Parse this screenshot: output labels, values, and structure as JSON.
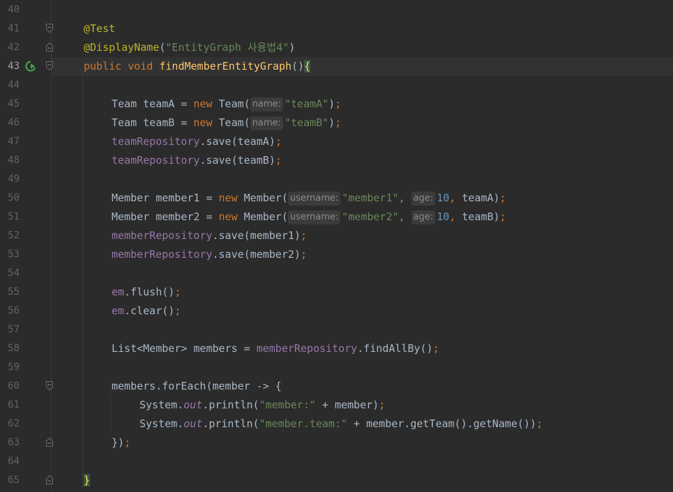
{
  "editor": {
    "current_line": "43",
    "lines": [
      {
        "n": "40",
        "tokens": []
      },
      {
        "n": "41",
        "tokens": [
          {
            "t": "@Test",
            "c": "ann"
          }
        ]
      },
      {
        "n": "42",
        "tokens": [
          {
            "t": "@DisplayName",
            "c": "ann"
          },
          {
            "t": "("
          },
          {
            "t": "\"EntityGraph 사용법4\"",
            "c": "str"
          },
          {
            "t": ")"
          }
        ]
      },
      {
        "n": "43",
        "tokens": [
          {
            "t": "public",
            "c": "kw"
          },
          {
            "t": " "
          },
          {
            "t": "void",
            "c": "kw"
          },
          {
            "t": " "
          },
          {
            "t": "findMemberEntityGraph",
            "c": "fn"
          },
          {
            "t": "()"
          },
          {
            "t": "{",
            "c": "brace-hl"
          }
        ]
      },
      {
        "n": "44",
        "tokens": []
      },
      {
        "n": "45",
        "tokens": [
          {
            "t": "Team teamA = "
          },
          {
            "t": "new",
            "c": "kw"
          },
          {
            "t": " Team("
          },
          {
            "t": "name:",
            "c": "hint"
          },
          {
            "t": "\"teamA\"",
            "c": "str"
          },
          {
            "t": ")"
          },
          {
            "t": ";",
            "c": "kw"
          }
        ]
      },
      {
        "n": "46",
        "tokens": [
          {
            "t": "Team teamB = "
          },
          {
            "t": "new",
            "c": "kw"
          },
          {
            "t": " Team("
          },
          {
            "t": "name:",
            "c": "hint"
          },
          {
            "t": "\"teamB\"",
            "c": "str"
          },
          {
            "t": ")"
          },
          {
            "t": ";",
            "c": "kw"
          }
        ]
      },
      {
        "n": "47",
        "tokens": [
          {
            "t": "teamRepository",
            "c": "fld"
          },
          {
            "t": ".save(teamA)"
          },
          {
            "t": ";",
            "c": "kw"
          }
        ]
      },
      {
        "n": "48",
        "tokens": [
          {
            "t": "teamRepository",
            "c": "fld"
          },
          {
            "t": ".save(teamB)"
          },
          {
            "t": ";",
            "c": "kw"
          }
        ]
      },
      {
        "n": "49",
        "tokens": []
      },
      {
        "n": "50",
        "tokens": [
          {
            "t": "Member member1 = "
          },
          {
            "t": "new",
            "c": "kw"
          },
          {
            "t": " Member("
          },
          {
            "t": "username:",
            "c": "hint"
          },
          {
            "t": "\"member1\"",
            "c": "str"
          },
          {
            "t": ",",
            "c": "kw"
          },
          {
            "t": " "
          },
          {
            "t": "age:",
            "c": "hint"
          },
          {
            "t": "10",
            "c": "num"
          },
          {
            "t": ",",
            "c": "kw"
          },
          {
            "t": " teamA)"
          },
          {
            "t": ";",
            "c": "kw"
          }
        ]
      },
      {
        "n": "51",
        "tokens": [
          {
            "t": "Member member2 = "
          },
          {
            "t": "new",
            "c": "kw"
          },
          {
            "t": " Member("
          },
          {
            "t": "username:",
            "c": "hint"
          },
          {
            "t": "\"member2\"",
            "c": "str"
          },
          {
            "t": ",",
            "c": "kw"
          },
          {
            "t": " "
          },
          {
            "t": "age:",
            "c": "hint"
          },
          {
            "t": "10",
            "c": "num"
          },
          {
            "t": ",",
            "c": "kw"
          },
          {
            "t": " teamB)"
          },
          {
            "t": ";",
            "c": "kw"
          }
        ]
      },
      {
        "n": "52",
        "tokens": [
          {
            "t": "memberRepository",
            "c": "fld"
          },
          {
            "t": ".save(member1)"
          },
          {
            "t": ";",
            "c": "kw"
          }
        ]
      },
      {
        "n": "53",
        "tokens": [
          {
            "t": "memberRepository",
            "c": "fld"
          },
          {
            "t": ".save(member2)"
          },
          {
            "t": ";",
            "c": "kw"
          }
        ]
      },
      {
        "n": "54",
        "tokens": []
      },
      {
        "n": "55",
        "tokens": [
          {
            "t": "em",
            "c": "fld"
          },
          {
            "t": ".flush()"
          },
          {
            "t": ";",
            "c": "kw"
          }
        ]
      },
      {
        "n": "56",
        "tokens": [
          {
            "t": "em",
            "c": "fld"
          },
          {
            "t": ".clear()"
          },
          {
            "t": ";",
            "c": "kw"
          }
        ]
      },
      {
        "n": "57",
        "tokens": []
      },
      {
        "n": "58",
        "tokens": [
          {
            "t": "List<Member> members = "
          },
          {
            "t": "memberRepository",
            "c": "fld"
          },
          {
            "t": ".findAllBy()"
          },
          {
            "t": ";",
            "c": "kw"
          }
        ]
      },
      {
        "n": "59",
        "tokens": []
      },
      {
        "n": "60",
        "tokens": [
          {
            "t": "members.forEach(member -> {"
          }
        ]
      },
      {
        "n": "61",
        "tokens": [
          {
            "t": "System."
          },
          {
            "t": "out",
            "c": "sfld"
          },
          {
            "t": ".println("
          },
          {
            "t": "\"member:\"",
            "c": "str"
          },
          {
            "t": " + member)"
          },
          {
            "t": ";",
            "c": "kw"
          }
        ]
      },
      {
        "n": "62",
        "tokens": [
          {
            "t": "System."
          },
          {
            "t": "out",
            "c": "sfld"
          },
          {
            "t": ".println("
          },
          {
            "t": "\"member.team:\"",
            "c": "str"
          },
          {
            "t": " + member.getTeam().getName())"
          },
          {
            "t": ";",
            "c": "kw"
          }
        ]
      },
      {
        "n": "63",
        "tokens": [
          {
            "t": "})"
          },
          {
            "t": ";",
            "c": "kw"
          }
        ]
      },
      {
        "n": "64",
        "tokens": []
      },
      {
        "n": "65",
        "tokens": [
          {
            "t": "}",
            "c": "brace-hl"
          }
        ]
      }
    ]
  },
  "colors": {
    "background": "#2b2b2b",
    "keyword": "#cc7832",
    "annotation": "#bbb529",
    "string": "#6a8759",
    "number": "#6897bb",
    "method_decl": "#ffc66d",
    "field": "#9876aa",
    "default_text": "#a9b7c6",
    "line_number": "#606366"
  },
  "icons": {
    "run": "run-test-icon",
    "fold_open": "fold-open-icon",
    "fold_close": "fold-close-icon"
  }
}
